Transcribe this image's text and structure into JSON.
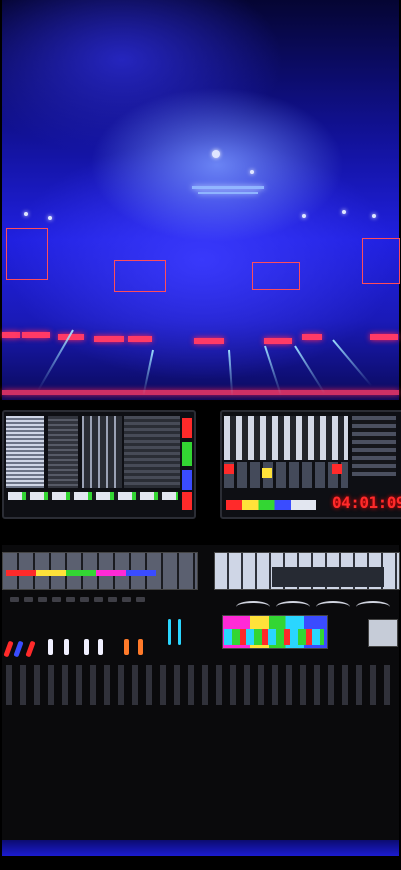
{
  "scene": {
    "description_tag": "stadium-lighting-console",
    "timecode": "04:01:09",
    "colors": {
      "sky": "#1a1ae0",
      "haze": "#7a8cff",
      "accent_pink": "#ff3a66",
      "timecode_red": "#ff2a2a",
      "beam": "#a0e6ff"
    }
  }
}
